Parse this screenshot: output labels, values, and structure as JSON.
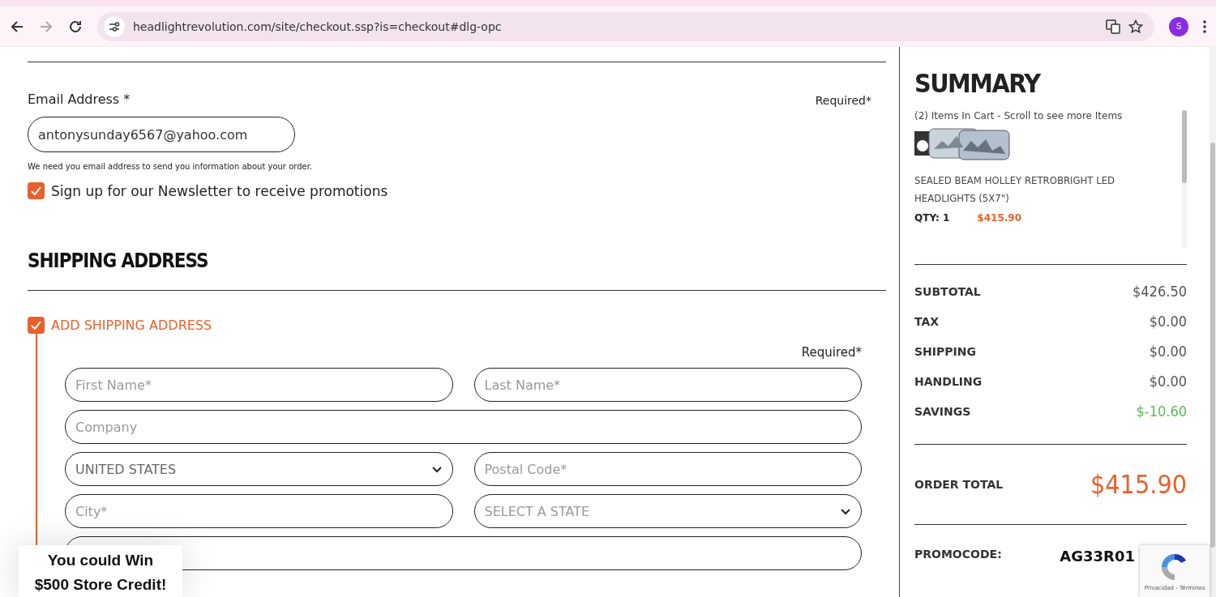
{
  "browser": {
    "url": "headlightrevolution.com/site/checkout.ssp?is=checkout#dlg-opc",
    "forward_disabled": true,
    "avatar": "S"
  },
  "email": {
    "label": "Email Address *",
    "required_note": "Required*",
    "value": "antonysunday6567@yahoo.com",
    "help": "We need you email address to send you information about your order."
  },
  "newsletter": {
    "label": "Sign up for our Newsletter to receive promotions",
    "checked": true
  },
  "shipping": {
    "heading": "SHIPPING ADDRESS",
    "toggle": {
      "label": "ADD SHIPPING ADDRESS",
      "checked": true
    },
    "required_note": "Required*",
    "rows": [
      [
        {
          "kind": "input",
          "placeholder": "First Name*"
        },
        {
          "kind": "input",
          "placeholder": "Last Name*"
        }
      ],
      [
        {
          "kind": "input",
          "placeholder": "Company"
        }
      ],
      [
        {
          "kind": "select",
          "value": "UNITED STATES"
        },
        {
          "kind": "input",
          "placeholder": "Postal Code*"
        }
      ],
      [
        {
          "kind": "input",
          "placeholder": "City*"
        },
        {
          "kind": "select",
          "placeholder": "SELECT A STATE"
        }
      ],
      [
        {
          "kind": "input"
        }
      ]
    ]
  },
  "summary": {
    "title": "SUMMARY",
    "cart_note": "(2) Items In Cart - Scroll to see more Items",
    "item": {
      "name": "SEALED BEAM HOLLEY RETROBRIGHT LED HEADLIGHTS (5X7\")",
      "qty": "QTY: 1",
      "price": "$415.90"
    },
    "lines": [
      {
        "label": "SUBTOTAL",
        "value": "$426.50",
        "color": "#555555"
      },
      {
        "label": "TAX",
        "value": "$0.00",
        "color": "#555555"
      },
      {
        "label": "SHIPPING",
        "value": "$0.00",
        "color": "#555555"
      },
      {
        "label": "HANDLING",
        "value": "$0.00",
        "color": "#555555"
      },
      {
        "label": "SAVINGS",
        "value": "$-10.60",
        "color": "#5cb85c"
      }
    ],
    "total": {
      "label": "ORDER TOTAL",
      "value": "$415.90"
    },
    "promo": {
      "label": "PROMOCODE:",
      "value": "AG33R01"
    }
  },
  "popup": {
    "lines": [
      "You could Win",
      "$500 Store Credit!"
    ]
  },
  "recaptcha": {
    "links": "Privacidad - Términos"
  }
}
